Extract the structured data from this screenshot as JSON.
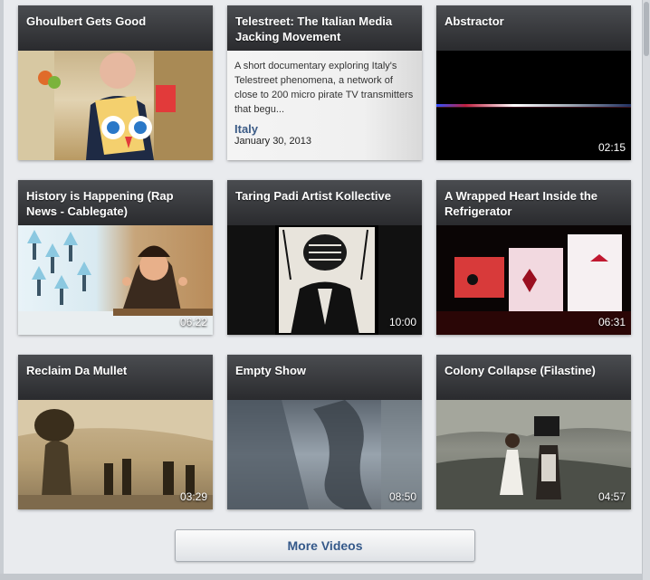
{
  "videos": [
    {
      "title": "Ghoulbert Gets Good",
      "duration": ""
    },
    {
      "title": "Telestreet: The Italian Media Jacking Movement",
      "duration": "",
      "description": "A short documentary exploring Italy's Telestreet phenomena, a network of close to 200 micro pirate TV transmitters that begu...",
      "tag": "Italy",
      "date": "January 30, 2013"
    },
    {
      "title": "Abstractor",
      "duration": "02:15"
    },
    {
      "title": "History is Happening (Rap News - Cablegate)",
      "duration": "06:22"
    },
    {
      "title": "Taring Padi Artist Kollective",
      "duration": "10:00"
    },
    {
      "title": "A Wrapped Heart Inside the Refrigerator",
      "duration": "06:31"
    },
    {
      "title": "Reclaim Da Mullet",
      "duration": "03:29"
    },
    {
      "title": "Empty Show",
      "duration": "08:50"
    },
    {
      "title": "Colony Collapse (Filastine)",
      "duration": "04:57"
    }
  ],
  "more_button": "More Videos"
}
